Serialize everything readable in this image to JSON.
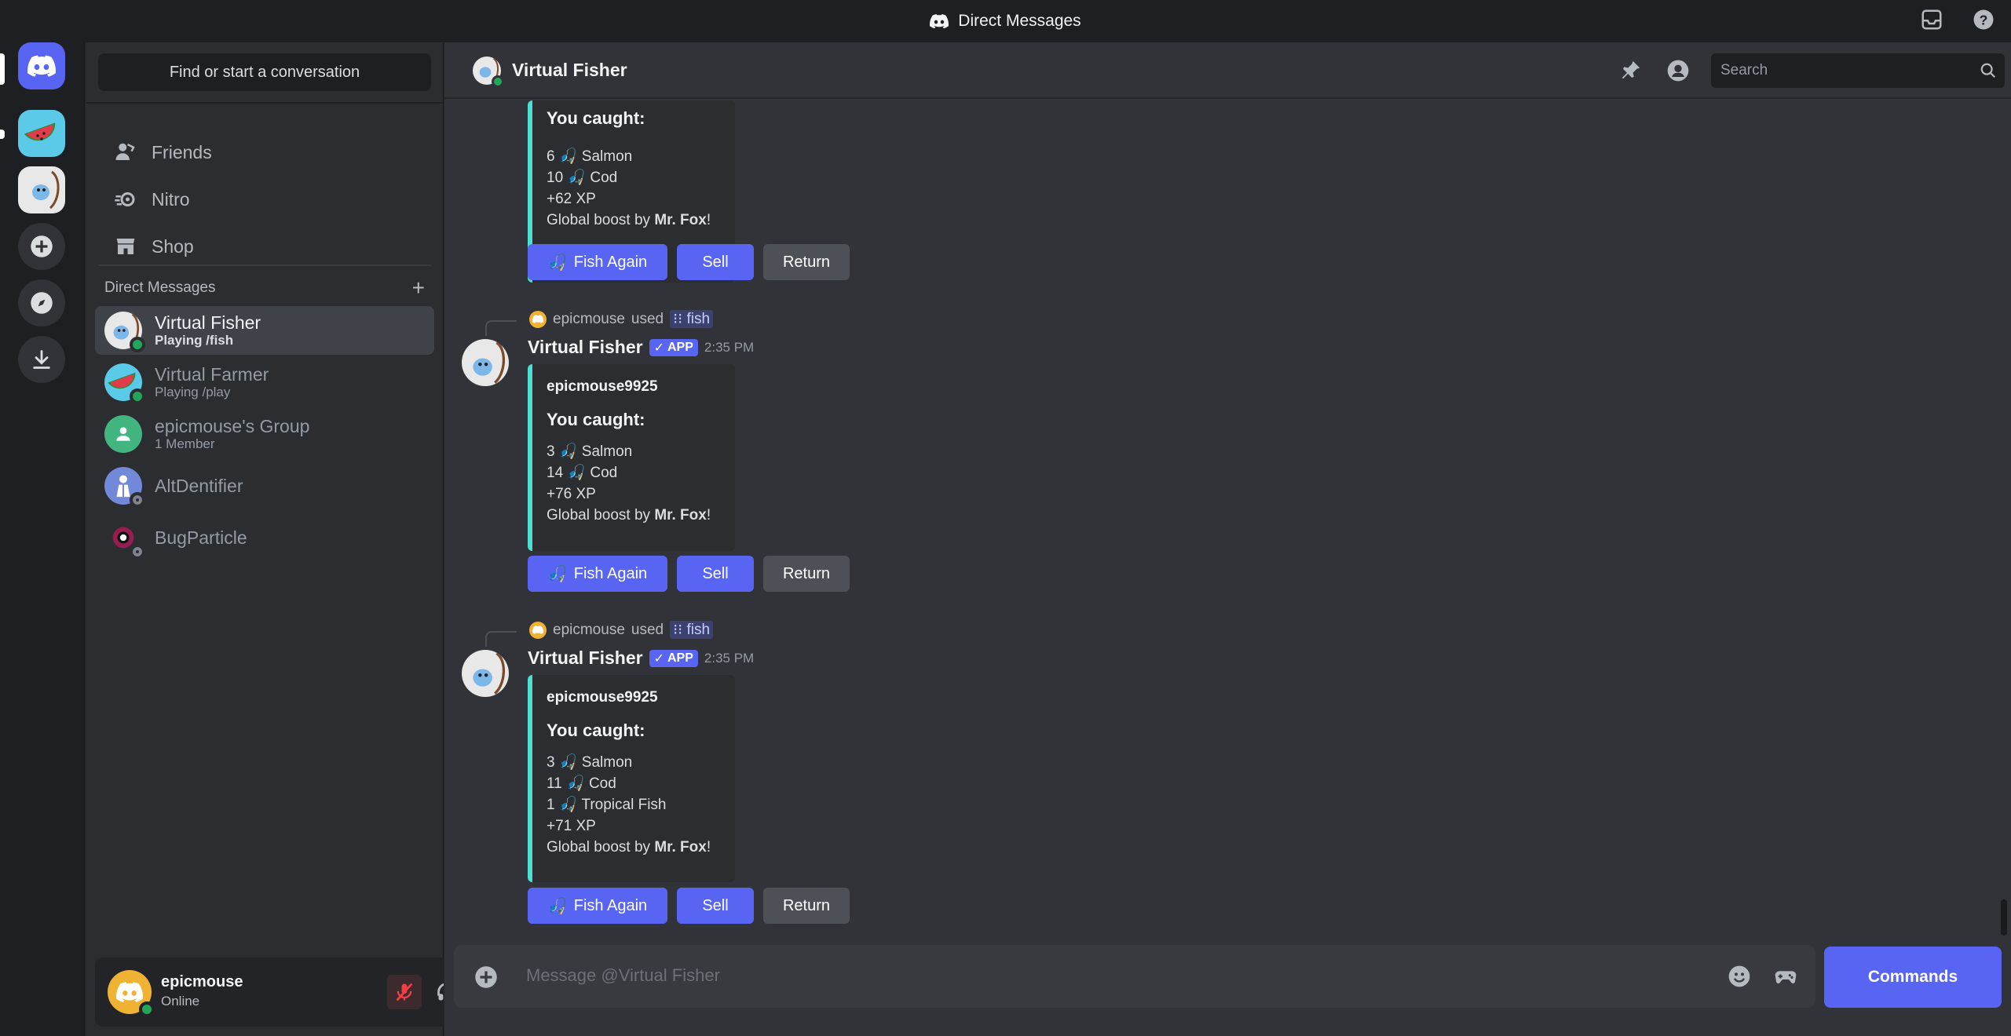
{
  "window": {
    "title": "Direct Messages"
  },
  "sidebar": {
    "search_label": "Find or start a conversation",
    "nav": [
      {
        "label": "Friends",
        "icon": "friends-icon"
      },
      {
        "label": "Nitro",
        "icon": "nitro-icon"
      },
      {
        "label": "Shop",
        "icon": "shop-icon"
      }
    ],
    "dm_header": "Direct Messages",
    "dms": [
      {
        "name": "Virtual Fisher",
        "sub": "Playing /fish",
        "status": "online"
      },
      {
        "name": "Virtual Farmer",
        "sub": "Playing /play",
        "status": "online"
      },
      {
        "name": "epicmouse's Group",
        "sub": "1 Member",
        "status": "none"
      },
      {
        "name": "AltDentifier",
        "sub": "",
        "status": "offline"
      },
      {
        "name": "BugParticle",
        "sub": "",
        "status": "offline"
      }
    ]
  },
  "user": {
    "name": "epicmouse",
    "status": "Online"
  },
  "channel": {
    "name": "Virtual Fisher",
    "search_placeholder": "Search"
  },
  "messages": [
    {
      "embed_title": "You caught:",
      "lines": [
        "6 🎣 Salmon",
        "10 🎣 Cod",
        "+62 XP"
      ],
      "boost_prefix": "Global boost by ",
      "boost_name": "Mr. Fox",
      "boost_suffix": "!"
    },
    {
      "reply_user": "epicmouse",
      "reply_used": "used",
      "reply_cmd": "fish",
      "author": "Virtual Fisher",
      "badge": "APP",
      "time": "2:35 PM",
      "embed_author": "epicmouse9925",
      "embed_title": "You caught:",
      "lines": [
        "3 🎣 Salmon",
        "14 🎣 Cod",
        "+76 XP"
      ],
      "boost_prefix": "Global boost by ",
      "boost_name": "Mr. Fox",
      "boost_suffix": "!"
    },
    {
      "reply_user": "epicmouse",
      "reply_used": "used",
      "reply_cmd": "fish",
      "author": "Virtual Fisher",
      "badge": "APP",
      "time": "2:35 PM",
      "embed_author": "epicmouse9925",
      "embed_title": "You caught:",
      "lines": [
        "3 🎣 Salmon",
        "11 🎣 Cod",
        "1 🎣 Tropical Fish",
        "+71 XP"
      ],
      "boost_prefix": "Global boost by ",
      "boost_name": "Mr. Fox",
      "boost_suffix": "!"
    }
  ],
  "buttons": {
    "fish_again": "Fish Again",
    "sell": "Sell",
    "return": "Return"
  },
  "composer": {
    "placeholder": "Message @Virtual Fisher",
    "commands": "Commands"
  },
  "colors": {
    "accent": "#5865f2",
    "embed_bar": "#4ce0d2",
    "online": "#23a55a"
  }
}
